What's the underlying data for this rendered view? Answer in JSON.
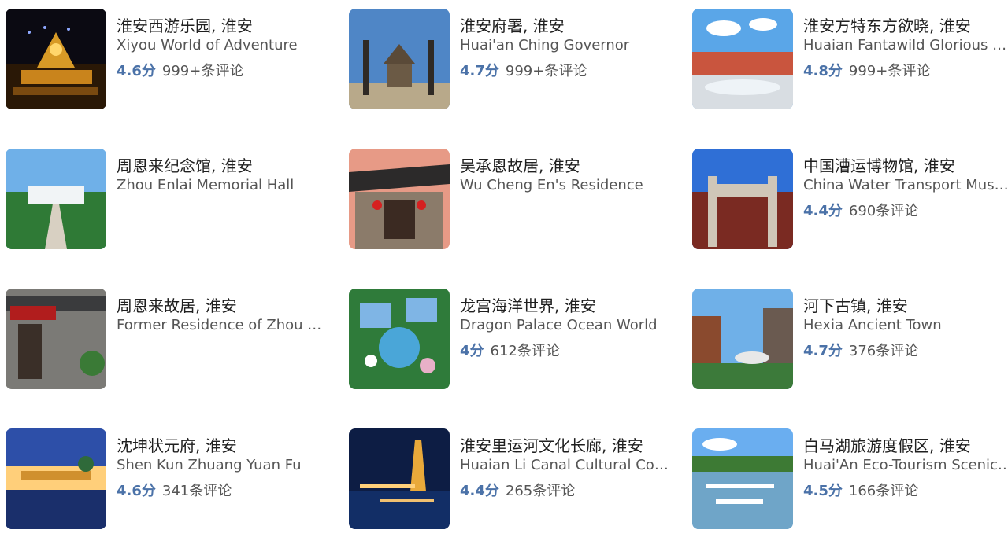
{
  "attractions": [
    {
      "name_cn": "淮安西游乐园, 淮安",
      "name_en": "Xiyou World of Adventure",
      "score": "4.6分",
      "reviews": "999+条评论"
    },
    {
      "name_cn": "淮安府署, 淮安",
      "name_en": "Huai'an Ching Governor",
      "score": "4.7分",
      "reviews": "999+条评论"
    },
    {
      "name_cn": "淮安方特东方欲晓, 淮安",
      "name_en": "Huaian Fantawild Glorious Orient",
      "score": "4.8分",
      "reviews": "999+条评论"
    },
    {
      "name_cn": "周恩来纪念馆, 淮安",
      "name_en": "Zhou Enlai Memorial Hall",
      "score": "",
      "reviews": ""
    },
    {
      "name_cn": "吴承恩故居, 淮安",
      "name_en": "Wu Cheng En's Residence",
      "score": "",
      "reviews": ""
    },
    {
      "name_cn": "中国漕运博物馆, 淮安",
      "name_en": "China Water Transport Museum",
      "score": "4.4分",
      "reviews": "690条评论"
    },
    {
      "name_cn": "周恩来故居, 淮安",
      "name_en": "Former Residence of Zhou Enlai",
      "score": "",
      "reviews": ""
    },
    {
      "name_cn": "龙宫海洋世界, 淮安",
      "name_en": "Dragon Palace Ocean World",
      "score": "4分",
      "reviews": "612条评论"
    },
    {
      "name_cn": "河下古镇, 淮安",
      "name_en": "Hexia Ancient Town",
      "score": "4.7分",
      "reviews": "376条评论"
    },
    {
      "name_cn": "沈坤状元府, 淮安",
      "name_en": "Shen Kun Zhuang Yuan Fu",
      "score": "4.6分",
      "reviews": "341条评论"
    },
    {
      "name_cn": "淮安里运河文化长廊, 淮安",
      "name_en": "Huaian Li Canal Cultural Corridor",
      "score": "4.4分",
      "reviews": "265条评论"
    },
    {
      "name_cn": "白马湖旅游度假区, 淮安",
      "name_en": "Huai'An Eco-Tourism Scenic Area",
      "score": "4.5分",
      "reviews": "166条评论"
    }
  ]
}
